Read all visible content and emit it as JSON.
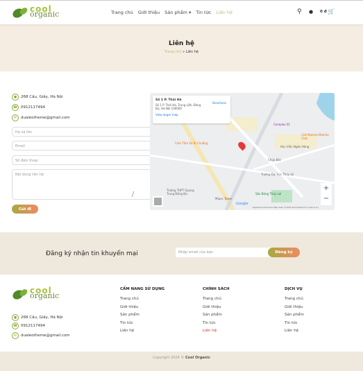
{
  "brand": {
    "line1": "cool",
    "line2": "organic"
  },
  "nav": [
    {
      "label": "Trang chủ"
    },
    {
      "label": "Giới thiệu"
    },
    {
      "label": "Sản phẩm ▾"
    },
    {
      "label": "Tin tức"
    },
    {
      "label": "Liên hệ"
    }
  ],
  "header": {
    "cart": "0 đ"
  },
  "banner": {
    "title": "Liên hệ",
    "crumb_home": "Trang chủ",
    "crumb_sep": " » ",
    "crumb_current": "Liên hệ"
  },
  "contact": {
    "address": "268 Cầu, Giấy, Hà Nội",
    "phone": "0912117494",
    "email": "dualeotheme@gmail.com"
  },
  "form": {
    "name": "Họ và tên",
    "email": "Email",
    "phone": "Số điện thoại",
    "message": "Nội dung liên hệ",
    "submit": "Gửi đi"
  },
  "map": {
    "place": "Số 1 P. Thái Hà",
    "address": "Số 1 P. Thái Hà, Trung Liệt, Đống Đa, Hà Nội 100000",
    "directions": "Directions",
    "larger": "View larger map",
    "labels": [
      "Complex 01",
      "CLB Matcha Matcha Club",
      "Học Viện Ngân Hàng",
      "Chùa Bộc",
      "Trường Đại học Thủy lợi",
      "Sân Bóng Thủy Lợi",
      "Mipec Tower",
      "Cơm Tấm Sà Bì Chưởng",
      "Trường THPT Quang Trung Đống Đa",
      "Google"
    ],
    "footer": "Keyboard shortcuts   Map data ©2022   Terms   Report a map error"
  },
  "newsletter": {
    "title": "Đăng ký nhận tin khuyến mại",
    "placeholder": "Nhập email của bạn",
    "button": "Đăng ký"
  },
  "footer": {
    "columns": [
      {
        "title": "CẨM NANG SỬ DỤNG",
        "links": [
          "Trang chủ",
          "Giới thiệu",
          "Sản phẩm",
          "Tin tức",
          "Liên hệ"
        ]
      },
      {
        "title": "CHÍNH SÁCH",
        "links": [
          "Trang chủ",
          "Giới thiệu",
          "Sản phẩm",
          "Tin tức",
          "Liên hệ"
        ]
      },
      {
        "title": "DỊCH VỤ",
        "links": [
          "Trang chủ",
          "Giới thiệu",
          "Sản phẩm",
          "Tin tức",
          "Liên hệ"
        ]
      }
    ]
  },
  "copyright": {
    "text": "Copyright 2024 © ",
    "brand": "Cool Organic"
  },
  "colors": {
    "accent": "#8aa83a",
    "banner": "#f6ede2",
    "gradient_start": "#a9a842",
    "gradient_end": "#ef8a62"
  }
}
